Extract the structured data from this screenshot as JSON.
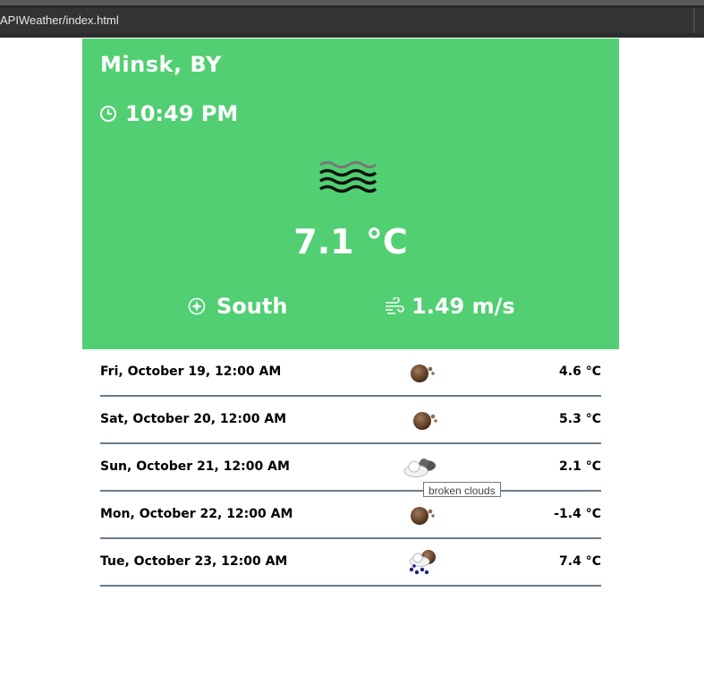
{
  "browser": {
    "url": "APIWeather/index.html"
  },
  "current": {
    "city": "Minsk, BY",
    "time": "10:49 PM",
    "condition_icon": "mist-icon",
    "temperature": "7.1 °C",
    "wind_direction": "South",
    "wind_speed": "1.49 m/s",
    "background_color": "#51cf72"
  },
  "forecast": [
    {
      "date": "Fri, October 19, 12:00 AM",
      "icon": "overcast-night-icon",
      "temp": "4.6 °C"
    },
    {
      "date": "Sat, October 20, 12:00 AM",
      "icon": "overcast-night-icon",
      "temp": "5.3 °C"
    },
    {
      "date": "Sun, October 21, 12:00 AM",
      "icon": "broken-clouds-icon",
      "temp": "2.1 °C"
    },
    {
      "date": "Mon, October 22, 12:00 AM",
      "icon": "overcast-night-icon",
      "temp": "-1.4 °C"
    },
    {
      "date": "Tue, October 23, 12:00 AM",
      "icon": "rain-night-icon",
      "temp": "7.4 °C"
    }
  ],
  "tooltip": {
    "text": "broken clouds"
  }
}
